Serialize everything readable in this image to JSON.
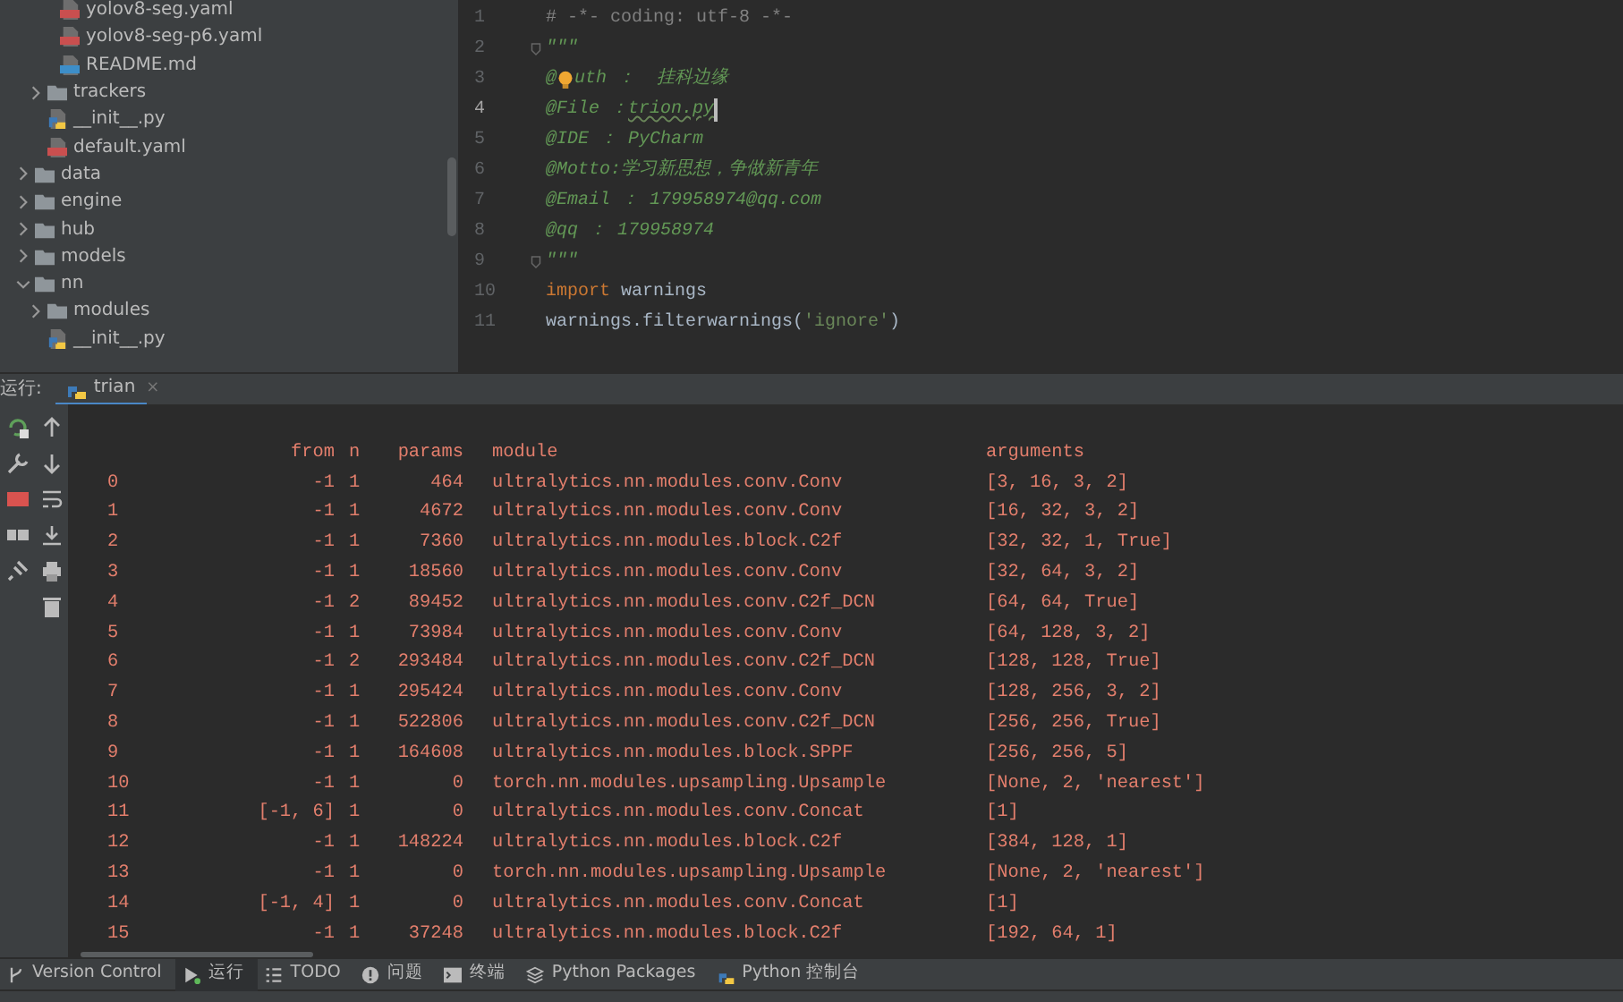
{
  "project_tree": [
    {
      "children": [
        {
          "children": [
            {
              "label": "yolov8-seg.yaml",
              "kind": "yaml"
            },
            {
              "label": "yolov8-seg-p6.yaml",
              "kind": "yaml"
            },
            {
              "label": "README.md",
              "kind": "md"
            }
          ]
        },
        {
          "label": "trackers",
          "kind": "folder",
          "expanded": false
        },
        {
          "label": "__init__.py",
          "kind": "py"
        },
        {
          "label": "default.yaml",
          "kind": "yaml"
        }
      ]
    },
    {
      "label": "data",
      "kind": "folder",
      "expanded": false
    },
    {
      "label": "engine",
      "kind": "folder",
      "expanded": false
    },
    {
      "label": "hub",
      "kind": "folder",
      "expanded": false
    },
    {
      "label": "models",
      "kind": "folder",
      "expanded": false
    },
    {
      "label": "nn",
      "kind": "folder",
      "expanded": true,
      "children": [
        {
          "label": "modules",
          "kind": "folder",
          "expanded": false
        },
        {
          "label": "__init__.py",
          "kind": "py"
        }
      ]
    }
  ],
  "editor": {
    "lines": [
      {
        "number": "1",
        "current": false,
        "fold": false,
        "tokens": [
          {
            "kind": "comment",
            "text": "# -*- coding: utf-8 -*-"
          }
        ]
      },
      {
        "number": "2",
        "current": false,
        "fold": true,
        "tokens": [
          {
            "kind": "doc",
            "text": "\"\"\""
          }
        ]
      },
      {
        "number": "3",
        "current": false,
        "fold": false,
        "tokens": [
          {
            "kind": "doc",
            "text": "@"
          },
          {
            "kind": "bulb"
          },
          {
            "kind": "doc",
            "text": "uth ：  挂科边缘"
          }
        ]
      },
      {
        "number": "4",
        "current": true,
        "fold": false,
        "tokens": [
          {
            "kind": "doc",
            "text": "@File ："
          },
          {
            "kind": "typo",
            "text": "trion.py"
          },
          {
            "kind": "caret"
          }
        ]
      },
      {
        "number": "5",
        "current": false,
        "fold": false,
        "tokens": [
          {
            "kind": "doc",
            "text": "@IDE ： PyCharm"
          }
        ]
      },
      {
        "number": "6",
        "current": false,
        "fold": false,
        "tokens": [
          {
            "kind": "doc",
            "text": "@Motto:学习新思想，争做新青年"
          }
        ]
      },
      {
        "number": "7",
        "current": false,
        "fold": false,
        "tokens": [
          {
            "kind": "doc",
            "text": "@Email ： 179958974@qq.com"
          }
        ]
      },
      {
        "number": "8",
        "current": false,
        "fold": false,
        "tokens": [
          {
            "kind": "doc",
            "text": "@qq ： 179958974"
          }
        ]
      },
      {
        "number": "9",
        "current": false,
        "fold": true,
        "tokens": [
          {
            "kind": "doc",
            "text": "\"\"\""
          }
        ]
      },
      {
        "number": "10",
        "current": false,
        "fold": false,
        "tokens": [
          {
            "kind": "keyword",
            "text": "import"
          },
          {
            "kind": "plain",
            "text": " warnings"
          }
        ]
      },
      {
        "number": "11",
        "current": false,
        "fold": false,
        "tokens": [
          {
            "kind": "plain",
            "text": "warnings.filterwarnings("
          },
          {
            "kind": "string",
            "text": "'ignore'"
          },
          {
            "kind": "plain",
            "text": ")"
          }
        ]
      }
    ]
  },
  "run_panel": {
    "label": "运行:",
    "tabs": [
      {
        "label": "trian",
        "selected": true,
        "close": "×"
      }
    ]
  },
  "console": {
    "columns": [
      "",
      "from",
      "n",
      "params",
      "module",
      "arguments"
    ],
    "rows": [
      [
        "0",
        "-1",
        "1",
        "464",
        "ultralytics.nn.modules.conv.Conv",
        "[3, 16, 3, 2]"
      ],
      [
        "1",
        "-1",
        "1",
        "4672",
        "ultralytics.nn.modules.conv.Conv",
        "[16, 32, 3, 2]"
      ],
      [
        "2",
        "-1",
        "1",
        "7360",
        "ultralytics.nn.modules.block.C2f",
        "[32, 32, 1, True]"
      ],
      [
        "3",
        "-1",
        "1",
        "18560",
        "ultralytics.nn.modules.conv.Conv",
        "[32, 64, 3, 2]"
      ],
      [
        "4",
        "-1",
        "2",
        "89452",
        "ultralytics.nn.modules.conv.C2f_DCN",
        "[64, 64, True]"
      ],
      [
        "5",
        "-1",
        "1",
        "73984",
        "ultralytics.nn.modules.conv.Conv",
        "[64, 128, 3, 2]"
      ],
      [
        "6",
        "-1",
        "2",
        "293484",
        "ultralytics.nn.modules.conv.C2f_DCN",
        "[128, 128, True]"
      ],
      [
        "7",
        "-1",
        "1",
        "295424",
        "ultralytics.nn.modules.conv.Conv",
        "[128, 256, 3, 2]"
      ],
      [
        "8",
        "-1",
        "1",
        "522806",
        "ultralytics.nn.modules.conv.C2f_DCN",
        "[256, 256, True]"
      ],
      [
        "9",
        "-1",
        "1",
        "164608",
        "ultralytics.nn.modules.block.SPPF",
        "[256, 256, 5]"
      ],
      [
        "10",
        "-1",
        "1",
        "0",
        "torch.nn.modules.upsampling.Upsample",
        "[None, 2, 'nearest']"
      ],
      [
        "11",
        "[-1, 6]",
        "1",
        "0",
        "ultralytics.nn.modules.conv.Concat",
        "[1]"
      ],
      [
        "12",
        "-1",
        "1",
        "148224",
        "ultralytics.nn.modules.block.C2f",
        "[384, 128, 1]"
      ],
      [
        "13",
        "-1",
        "1",
        "0",
        "torch.nn.modules.upsampling.Upsample",
        "[None, 2, 'nearest']"
      ],
      [
        "14",
        "[-1, 4]",
        "1",
        "0",
        "ultralytics.nn.modules.conv.Concat",
        "[1]"
      ],
      [
        "15",
        "-1",
        "1",
        "37248",
        "ultralytics.nn.modules.block.C2f",
        "[192, 64, 1]"
      ]
    ]
  },
  "tool_window_bar": [
    {
      "label": "Version Control",
      "kind": "vcs",
      "selected": false
    },
    {
      "label": "运行",
      "kind": "run",
      "selected": true
    },
    {
      "label": "TODO",
      "kind": "todo",
      "selected": false
    },
    {
      "label": "问题",
      "kind": "problems",
      "selected": false
    },
    {
      "label": "终端",
      "kind": "terminal",
      "selected": false
    },
    {
      "label": "Python Packages",
      "kind": "packages",
      "selected": false
    },
    {
      "label": "Python 控制台",
      "kind": "console",
      "selected": false
    }
  ]
}
